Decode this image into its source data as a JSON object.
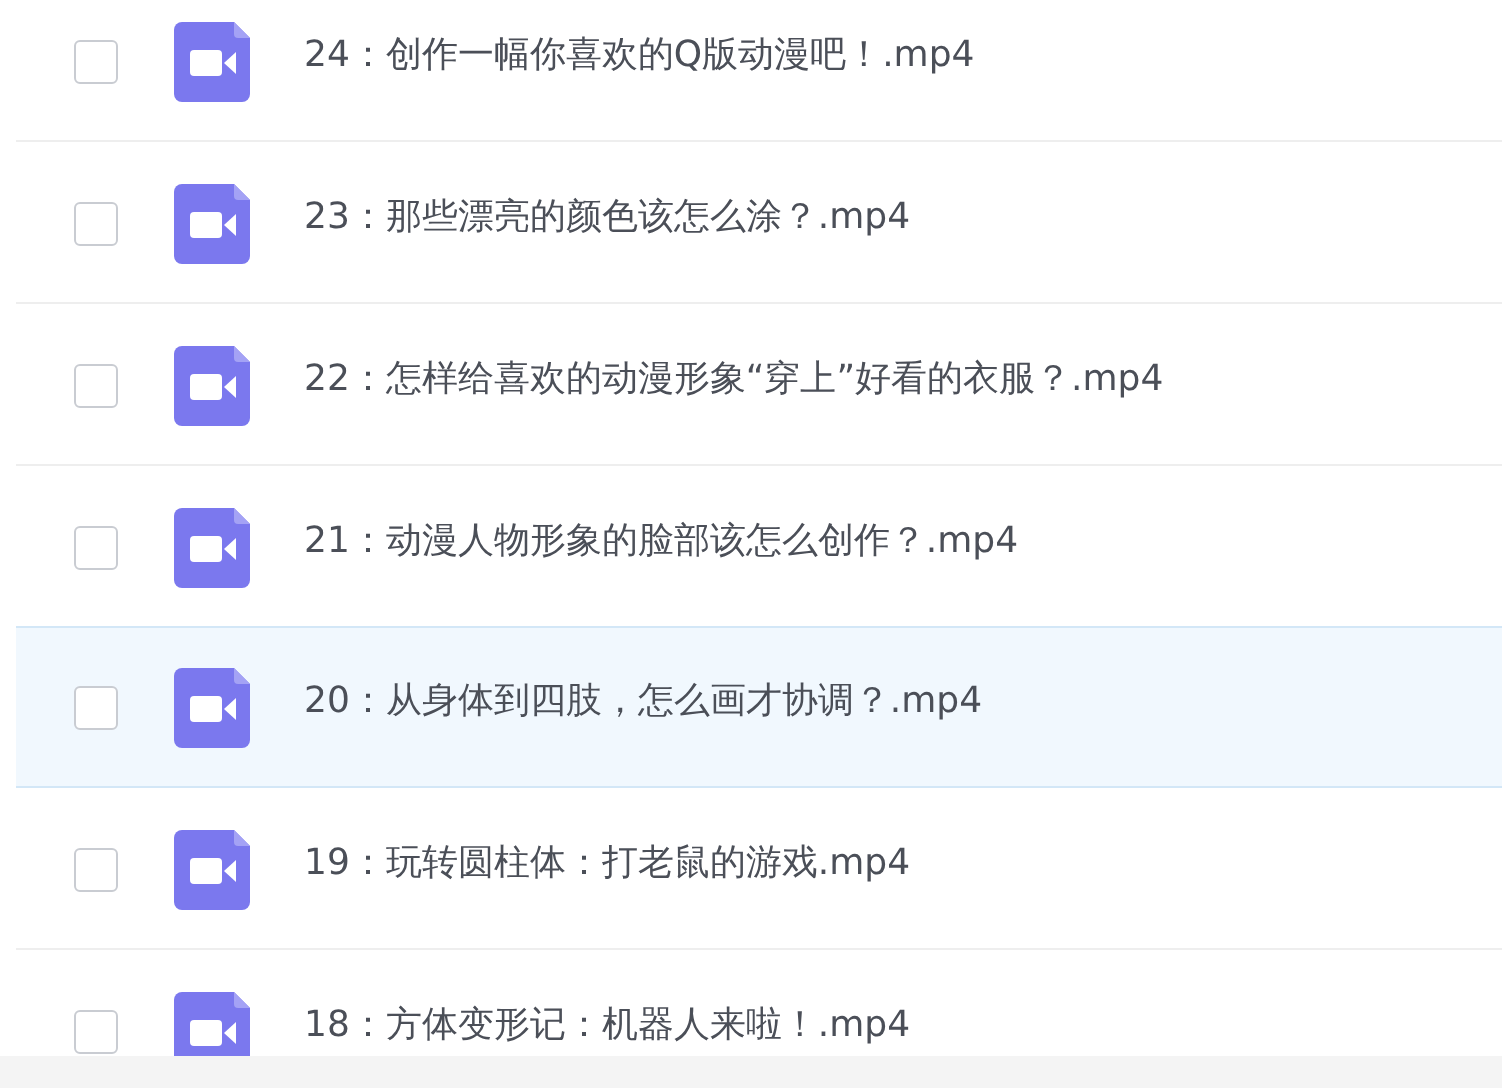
{
  "files": [
    {
      "name": "24：创作一幅你喜欢的Q版动漫吧！.mp4",
      "checked": false,
      "highlighted": false
    },
    {
      "name": "23：那些漂亮的颜色该怎么涂？.mp4",
      "checked": false,
      "highlighted": false
    },
    {
      "name": "22：怎样给喜欢的动漫形象“穿上”好看的衣服？.mp4",
      "checked": false,
      "highlighted": false
    },
    {
      "name": "21：动漫人物形象的脸部该怎么创作？.mp4",
      "checked": false,
      "highlighted": false
    },
    {
      "name": "20：从身体到四肢，怎么画才协调？.mp4",
      "checked": false,
      "highlighted": true
    },
    {
      "name": "19：玩转圆柱体：打老鼠的游戏.mp4",
      "checked": false,
      "highlighted": false
    },
    {
      "name": "18：方体变形记：机器人来啦！.mp4",
      "checked": false,
      "highlighted": false
    }
  ]
}
